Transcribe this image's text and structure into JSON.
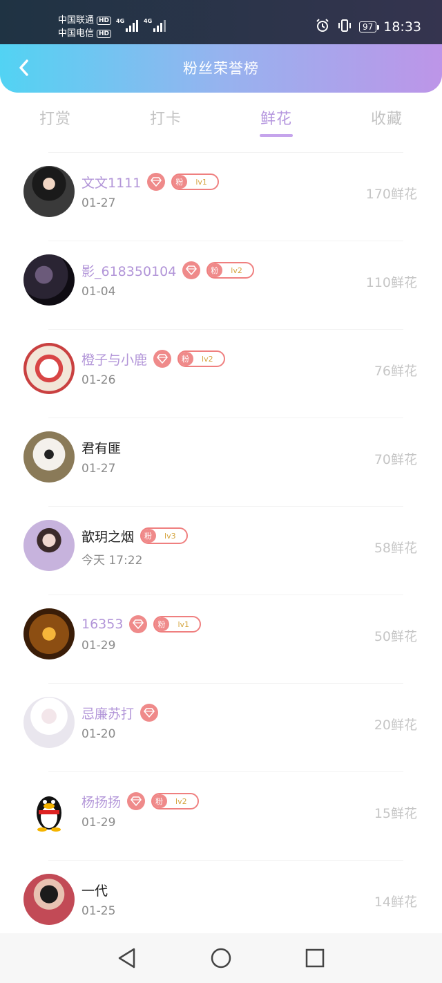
{
  "statusbar": {
    "carrier1": "中国联通",
    "carrier2": "中国电信",
    "hd": "HD",
    "network": "4G",
    "battery": "97",
    "time": "18:33"
  },
  "header": {
    "title": "粉丝荣誉榜"
  },
  "tabs": [
    {
      "label": "打赏",
      "active": false
    },
    {
      "label": "打卡",
      "active": false
    },
    {
      "label": "鲜花",
      "active": true
    },
    {
      "label": "收藏",
      "active": false
    }
  ],
  "level_badge_prefix": "粉",
  "fans": [
    {
      "name": "文文1111",
      "date": "01-27",
      "count": "170鲜花",
      "level": "lv1",
      "highlight": true
    },
    {
      "name": "影_618350104",
      "date": "01-04",
      "count": "110鲜花",
      "level": "lv2",
      "highlight": true
    },
    {
      "name": "橙子与小鹿",
      "date": "01-26",
      "count": "76鲜花",
      "level": "lv2",
      "highlight": true
    },
    {
      "name": "君有匪",
      "date": "01-27",
      "count": "70鲜花",
      "level": "",
      "highlight": false
    },
    {
      "name": "歆玥之烟",
      "date": "今天 17:22",
      "count": "58鲜花",
      "level": "lv3",
      "highlight": false
    },
    {
      "name": "16353",
      "date": "01-29",
      "count": "50鲜花",
      "level": "lv1",
      "highlight": true
    },
    {
      "name": "忌廉苏打",
      "date": "01-20",
      "count": "20鲜花",
      "level": "",
      "highlight": true
    },
    {
      "name": "杨扬扬",
      "date": "01-29",
      "count": "15鲜花",
      "level": "lv2",
      "highlight": true
    },
    {
      "name": "一代",
      "date": "01-25",
      "count": "14鲜花",
      "level": "",
      "highlight": false
    }
  ],
  "colors": {
    "accent": "#b495de",
    "badge": "#ef8a8a",
    "level_text": "#d4a33c"
  }
}
